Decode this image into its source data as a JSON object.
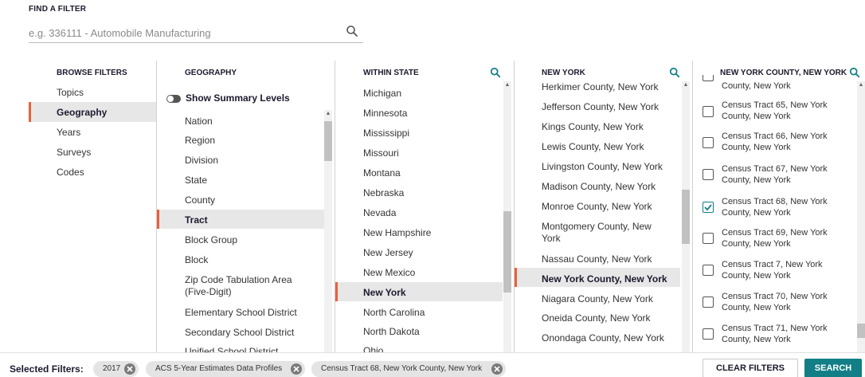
{
  "find_filter": {
    "title": "FIND A FILTER",
    "search_placeholder": "e.g. 336111 - Automobile Manufacturing"
  },
  "browse": {
    "header": "BROWSE FILTERS",
    "items": [
      "Topics",
      "Geography",
      "Years",
      "Surveys",
      "Codes"
    ],
    "selected": "Geography"
  },
  "geography": {
    "header": "GEOGRAPHY",
    "toggle_label": "Show Summary Levels",
    "items": [
      "Nation",
      "Region",
      "Division",
      "State",
      "County",
      "Tract",
      "Block Group",
      "Block",
      "Zip Code Tabulation Area (Five-Digit)",
      "Elementary School District",
      "Secondary School District",
      "Unified School District"
    ],
    "selected": "Tract"
  },
  "within_state": {
    "header": "WITHIN STATE",
    "items": [
      "Michigan",
      "Minnesota",
      "Mississippi",
      "Missouri",
      "Montana",
      "Nebraska",
      "Nevada",
      "New Hampshire",
      "New Jersey",
      "New Mexico",
      "New York",
      "North Carolina",
      "North Dakota",
      "Ohio"
    ],
    "selected": "New York"
  },
  "new_york": {
    "header": "NEW YORK",
    "items": [
      "Herkimer County, New York",
      "Jefferson County, New York",
      "Kings County, New York",
      "Lewis County, New York",
      "Livingston County, New York",
      "Madison County, New York",
      "Monroe County, New York",
      "Montgomery County, New York",
      "Nassau County, New York",
      "New York County, New York",
      "Niagara County, New York",
      "Oneida County, New York",
      "Onondaga County, New York"
    ],
    "selected": "New York County, New York"
  },
  "county": {
    "header": "NEW YORK COUNTY, NEW YORK",
    "partial_item": "County, New York",
    "items": [
      {
        "line1": "Census Tract 65, New York",
        "line2": "County, New York",
        "checked": false
      },
      {
        "line1": "Census Tract 66, New York",
        "line2": "County, New York",
        "checked": false
      },
      {
        "line1": "Census Tract 67, New York",
        "line2": "County, New York",
        "checked": false
      },
      {
        "line1": "Census Tract 68, New York",
        "line2": "County, New York",
        "checked": true
      },
      {
        "line1": "Census Tract 69, New York",
        "line2": "County, New York",
        "checked": false
      },
      {
        "line1": "Census Tract 7, New York",
        "line2": "County, New York",
        "checked": false
      },
      {
        "line1": "Census Tract 70, New York",
        "line2": "County, New York",
        "checked": false
      },
      {
        "line1": "Census Tract 71, New York",
        "line2": "County, New York",
        "checked": false
      }
    ]
  },
  "footer": {
    "label": "Selected Filters:",
    "chips": [
      "2017",
      "ACS 5-Year Estimates Data Profiles",
      "Census Tract 68, New York County, New York"
    ],
    "clear_label": "CLEAR FILTERS",
    "search_label": "SEARCH"
  },
  "colors": {
    "accent": "#e8613c",
    "teal": "#127e86",
    "selected_bg": "#e7e7e7"
  }
}
